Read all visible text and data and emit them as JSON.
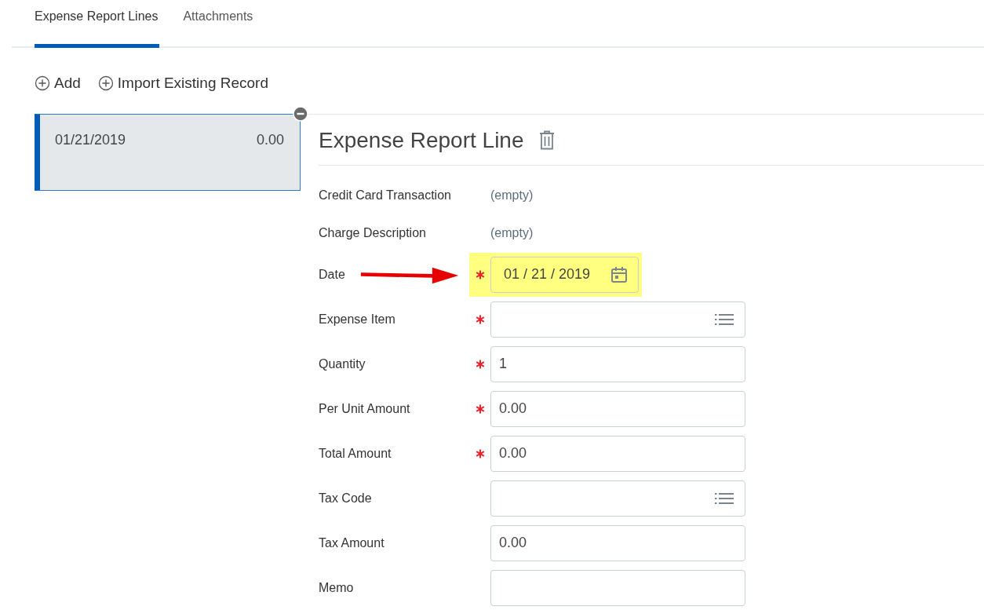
{
  "tabs": [
    {
      "label": "Expense Report Lines",
      "selected": true
    },
    {
      "label": "Attachments",
      "selected": false
    }
  ],
  "actions": [
    "Add",
    "Import Existing Record"
  ],
  "lines": [
    {
      "date": "01/21/2019",
      "amount": "0.00",
      "selected": true
    }
  ],
  "detail": {
    "title": "Expense Report Line",
    "fields": [
      {
        "label": "Credit Card Transaction",
        "kind": "readonly",
        "value": "(empty)",
        "required": false
      },
      {
        "label": "Charge Description",
        "kind": "readonly",
        "value": "(empty)",
        "required": false
      },
      {
        "label": "Date",
        "kind": "date",
        "value": "01 / 21 / 2019",
        "required": true,
        "highlighted": true
      },
      {
        "label": "Expense Item",
        "kind": "prompt",
        "required": true
      },
      {
        "label": "Quantity",
        "kind": "text",
        "value": "1",
        "required": true
      },
      {
        "label": "Per Unit Amount",
        "kind": "text",
        "value": "0.00",
        "required": true
      },
      {
        "label": "Total Amount",
        "kind": "text",
        "value": "0.00",
        "required": true
      },
      {
        "label": "Tax Code",
        "kind": "prompt",
        "required": false
      },
      {
        "label": "Tax Amount",
        "kind": "text",
        "value": "0.00",
        "required": false
      },
      {
        "label": "Memo",
        "kind": "text",
        "required": false
      }
    ]
  }
}
